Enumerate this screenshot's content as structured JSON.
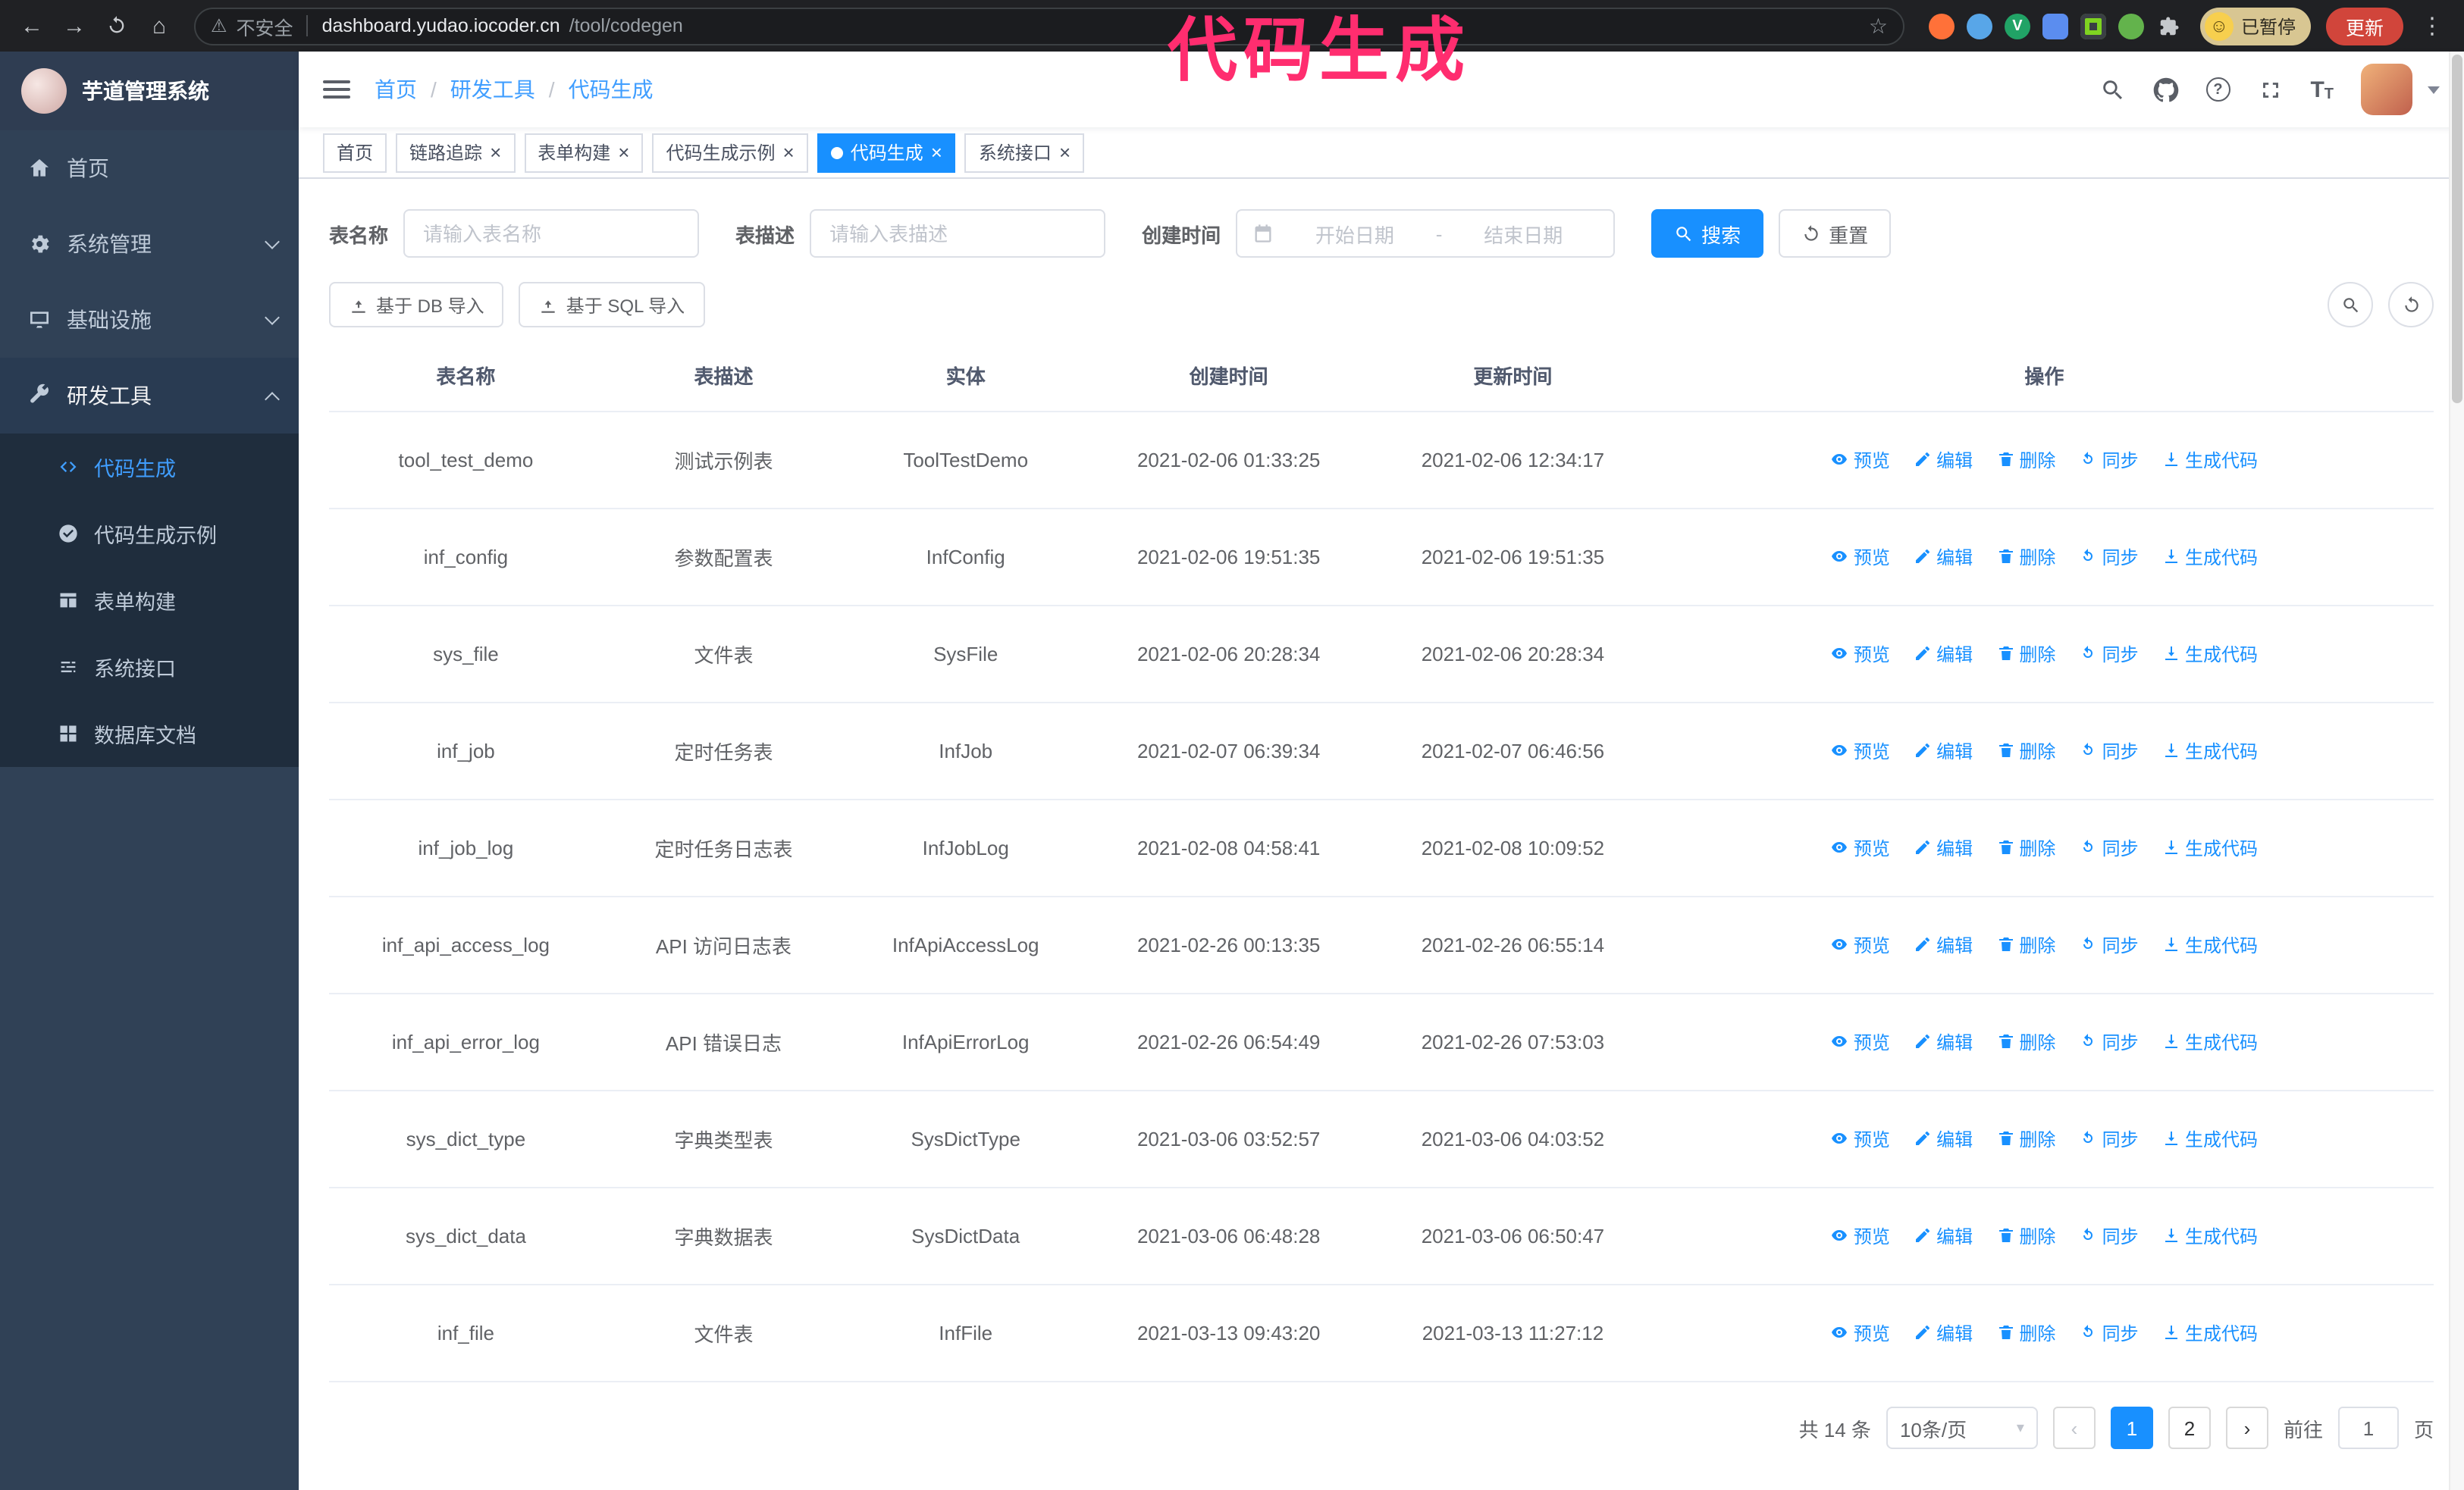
{
  "colors": {
    "primary": "#1890ff",
    "annotation": "#ff2d6f",
    "sidebar_bg": "#304156"
  },
  "annotation": {
    "text": "代码生成"
  },
  "browser": {
    "security_label": "不安全",
    "url_host": "dashboard.yudao.iocoder.cn",
    "url_path": "/tool/codegen",
    "paused_badge": "已暂停",
    "update_label": "更新"
  },
  "app": {
    "title": "芋道管理系统"
  },
  "sidebar": {
    "items": [
      {
        "label": "首页"
      },
      {
        "label": "系统管理"
      },
      {
        "label": "基础设施"
      },
      {
        "label": "研发工具"
      }
    ],
    "submenu": [
      {
        "label": "代码生成"
      },
      {
        "label": "代码生成示例"
      },
      {
        "label": "表单构建"
      },
      {
        "label": "系统接口"
      },
      {
        "label": "数据库文档"
      }
    ]
  },
  "breadcrumb": {
    "items": [
      "首页",
      "研发工具",
      "代码生成"
    ]
  },
  "tabs": [
    {
      "label": "首页"
    },
    {
      "label": "链路追踪"
    },
    {
      "label": "表单构建"
    },
    {
      "label": "代码生成示例"
    },
    {
      "label": "代码生成"
    },
    {
      "label": "系统接口"
    }
  ],
  "filters": {
    "table_name_label": "表名称",
    "table_name_placeholder": "请输入表名称",
    "table_desc_label": "表描述",
    "table_desc_placeholder": "请输入表描述",
    "create_time_label": "创建时间",
    "date_start_placeholder": "开始日期",
    "date_separator": "-",
    "date_end_placeholder": "结束日期",
    "search_label": "搜索",
    "reset_label": "重置"
  },
  "toolbar": {
    "import_db_label": "基于 DB 导入",
    "import_sql_label": "基于 SQL 导入"
  },
  "table": {
    "columns": [
      "表名称",
      "表描述",
      "实体",
      "创建时间",
      "更新时间",
      "操作"
    ],
    "actions": [
      "预览",
      "编辑",
      "删除",
      "同步",
      "生成代码"
    ],
    "rows": [
      {
        "name": "tool_test_demo",
        "desc": "测试示例表",
        "entity": "ToolTestDemo",
        "created": "2021-02-06 01:33:25",
        "updated": "2021-02-06 12:34:17"
      },
      {
        "name": "inf_config",
        "desc": "参数配置表",
        "entity": "InfConfig",
        "created": "2021-02-06 19:51:35",
        "updated": "2021-02-06 19:51:35"
      },
      {
        "name": "sys_file",
        "desc": "文件表",
        "entity": "SysFile",
        "created": "2021-02-06 20:28:34",
        "updated": "2021-02-06 20:28:34"
      },
      {
        "name": "inf_job",
        "desc": "定时任务表",
        "entity": "InfJob",
        "created": "2021-02-07 06:39:34",
        "updated": "2021-02-07 06:46:56"
      },
      {
        "name": "inf_job_log",
        "desc": "定时任务日志表",
        "entity": "InfJobLog",
        "created": "2021-02-08 04:58:41",
        "updated": "2021-02-08 10:09:52"
      },
      {
        "name": "inf_api_access_log",
        "desc": "API 访问日志表",
        "entity": "InfApiAccessLog",
        "created": "2021-02-26 00:13:35",
        "updated": "2021-02-26 06:55:14"
      },
      {
        "name": "inf_api_error_log",
        "desc": "API 错误日志",
        "entity": "InfApiErrorLog",
        "created": "2021-02-26 06:54:49",
        "updated": "2021-02-26 07:53:03"
      },
      {
        "name": "sys_dict_type",
        "desc": "字典类型表",
        "entity": "SysDictType",
        "created": "2021-03-06 03:52:57",
        "updated": "2021-03-06 04:03:52"
      },
      {
        "name": "sys_dict_data",
        "desc": "字典数据表",
        "entity": "SysDictData",
        "created": "2021-03-06 06:48:28",
        "updated": "2021-03-06 06:50:47"
      },
      {
        "name": "inf_file",
        "desc": "文件表",
        "entity": "InfFile",
        "created": "2021-03-13 09:43:20",
        "updated": "2021-03-13 11:27:12"
      }
    ]
  },
  "pagination": {
    "total_label": "共 14 条",
    "page_size": "10条/页",
    "pages": [
      "1",
      "2"
    ],
    "goto_label": "前往",
    "goto_value": "1",
    "goto_suffix": "页"
  }
}
